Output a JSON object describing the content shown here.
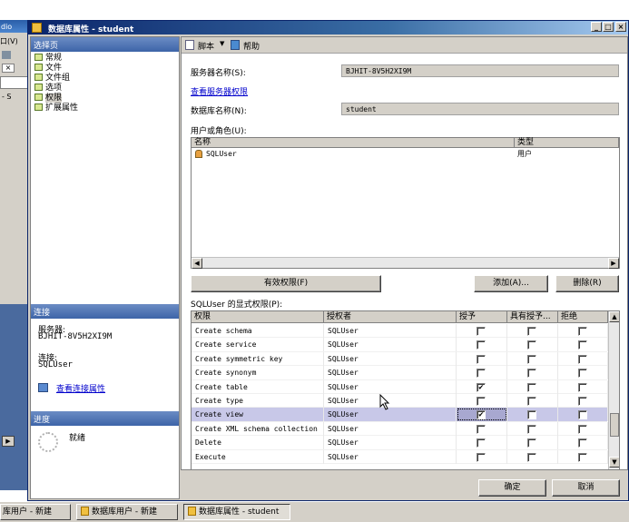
{
  "background_app": {
    "title_fragment": "dio",
    "menu_fragment": "口(V)",
    "close_glyph": "×",
    "tree_fragment": "- S"
  },
  "dialog": {
    "title": "数据库属性 - student",
    "controls": {
      "minimize": "_",
      "maximize": "□",
      "close": "×"
    }
  },
  "left_pane": {
    "select_page_header": "选择页",
    "pages": [
      {
        "label": "常规"
      },
      {
        "label": "文件"
      },
      {
        "label": "文件组"
      },
      {
        "label": "选项"
      },
      {
        "label": "权限",
        "selected": true
      },
      {
        "label": "扩展属性"
      }
    ],
    "connection_header": "连接",
    "server_label": "服务器:",
    "server_value": "BJHIT-8V5H2XI9M",
    "connection_label": "连接:",
    "connection_value": "SQLUser",
    "view_connection_link": "查看连接属性",
    "progress_header": "进度",
    "progress_status": "就绪"
  },
  "toolbar": {
    "script_label": "脚本",
    "help_label": "帮助"
  },
  "form": {
    "server_name_label": "服务器名称(S):",
    "server_name_value": "BJHIT-8V5H2XI9M",
    "view_server_permissions_link": "查看服务器权限",
    "database_name_label": "数据库名称(N):",
    "database_name_value": "student",
    "users_roles_label": "用户或角色(U):"
  },
  "users_table": {
    "columns": [
      "名称",
      "类型"
    ],
    "rows": [
      {
        "name": "SQLUser",
        "type": "用户"
      }
    ]
  },
  "buttons": {
    "effective_permissions": "有效权限(F)",
    "add": "添加(A)...",
    "remove": "删除(R)",
    "ok": "确定",
    "cancel": "取消"
  },
  "explicit_permissions_label": "SQLUser 的显式权限(P):",
  "permissions_table": {
    "columns": [
      "权限",
      "授权者",
      "授予",
      "具有授予...",
      "拒绝"
    ],
    "rows": [
      {
        "permission": "Create schema",
        "grantor": "SQLUser",
        "grant": false,
        "with_grant": false,
        "deny": false
      },
      {
        "permission": "Create service",
        "grantor": "SQLUser",
        "grant": false,
        "with_grant": false,
        "deny": false
      },
      {
        "permission": "Create symmetric key",
        "grantor": "SQLUser",
        "grant": false,
        "with_grant": false,
        "deny": false
      },
      {
        "permission": "Create synonym",
        "grantor": "SQLUser",
        "grant": false,
        "with_grant": false,
        "deny": false
      },
      {
        "permission": "Create table",
        "grantor": "SQLUser",
        "grant": true,
        "with_grant": false,
        "deny": false
      },
      {
        "permission": "Create type",
        "grantor": "SQLUser",
        "grant": false,
        "with_grant": false,
        "deny": false
      },
      {
        "permission": "Create view",
        "grantor": "SQLUser",
        "grant": true,
        "with_grant": false,
        "deny": false,
        "selected": true
      },
      {
        "permission": "Create XML schema collection",
        "grantor": "SQLUser",
        "grant": false,
        "with_grant": false,
        "deny": false
      },
      {
        "permission": "Delete",
        "grantor": "SQLUser",
        "grant": false,
        "with_grant": false,
        "deny": false
      },
      {
        "permission": "Execute",
        "grantor": "SQLUser",
        "grant": false,
        "with_grant": false,
        "deny": false
      }
    ]
  },
  "taskbar": {
    "items": [
      {
        "label": "库用户 - 新建"
      },
      {
        "label": "数据库用户 - 新建"
      },
      {
        "label": "数据库属性 - student",
        "active": true
      }
    ]
  },
  "colors": {
    "title_bar": "#0a246a",
    "section_header": "#3d64a8",
    "selected_row": "#c8c8e8",
    "link": "#0000cc"
  }
}
